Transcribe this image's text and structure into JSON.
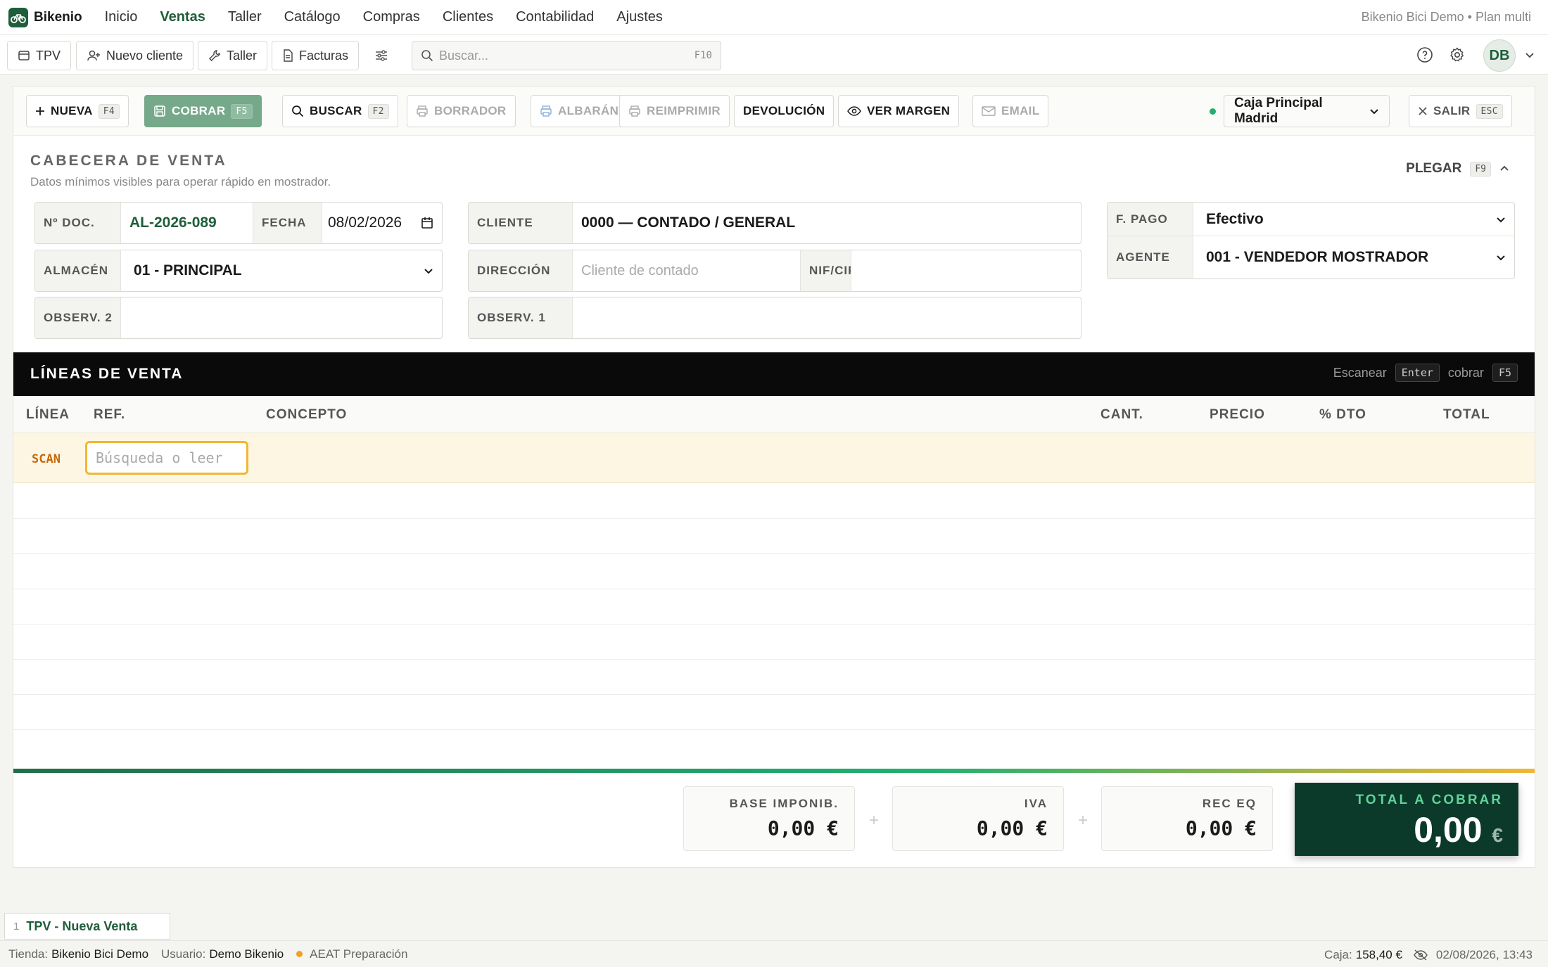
{
  "app": {
    "name": "Bikenio",
    "account": "Bikenio Bici Demo • Plan multi"
  },
  "nav": [
    "Inicio",
    "Ventas",
    "Taller",
    "Catálogo",
    "Compras",
    "Clientes",
    "Contabilidad",
    "Ajustes"
  ],
  "nav_active": "Ventas",
  "toolbar": {
    "tpv": "TPV",
    "nuevo_cliente": "Nuevo cliente",
    "taller": "Taller",
    "facturas": "Facturas",
    "search_placeholder": "Buscar...",
    "search_kbd": "F10",
    "avatar": "DB"
  },
  "actions": {
    "nueva": "NUEVA",
    "nueva_kbd": "F4",
    "cobrar": "COBRAR",
    "cobrar_kbd": "F5",
    "buscar": "BUSCAR",
    "buscar_kbd": "F2",
    "borrador": "BORRADOR",
    "albaran": "ALBARÁN",
    "reimprimir": "REIMPRIMIR",
    "devolucion": "DEVOLUCIÓN",
    "ver_margen": "VER MARGEN",
    "email": "EMAIL",
    "caja": "Caja Principal Madrid",
    "salir": "SALIR",
    "salir_kbd": "ESC"
  },
  "header": {
    "title": "CABECERA DE VENTA",
    "subtitle": "Datos mínimos visibles para operar rápido en mostrador.",
    "plegar": "PLEGAR",
    "plegar_kbd": "F9",
    "ndoc_label": "Nº DOC.",
    "ndoc": "AL-2026-089",
    "fecha_label": "FECHA",
    "fecha": "08/02/2026",
    "almacen_label": "ALMACÉN",
    "almacen": "01 - PRINCIPAL",
    "observ2_label": "OBSERV. 2",
    "observ2": "",
    "cliente_label": "CLIENTE",
    "cliente": "0000 — CONTADO / GENERAL",
    "direccion_label": "DIRECCIÓN",
    "direccion_placeholder": "Cliente de contado",
    "nif_label": "NIF/CIF",
    "nif": "",
    "observ1_label": "OBSERV. 1",
    "observ1": "",
    "fpago_label": "F. PAGO",
    "fpago": "Efectivo",
    "agente_label": "AGENTE",
    "agente": "001 - VENDEDOR MOSTRADOR"
  },
  "lines": {
    "title": "LÍNEAS DE VENTA",
    "hint_scan": "Escanear",
    "hint_enter": "Enter",
    "hint_cobrar": "cobrar",
    "hint_f5": "F5",
    "columns": [
      "LÍNEA",
      "REF.",
      "CONCEPTO",
      "CANT.",
      "PRECIO",
      "% DTO",
      "TOTAL"
    ],
    "scan_label": "SCAN",
    "scan_placeholder": "Búsqueda o leer"
  },
  "totals": {
    "base_label": "BASE IMPONIB.",
    "base": "0,00 €",
    "iva_label": "IVA",
    "iva": "0,00 €",
    "receq_label": "REC EQ",
    "receq": "0,00 €",
    "plus": "+",
    "total_label": "TOTAL A COBRAR",
    "total": "0,00",
    "currency": "€"
  },
  "tabs": [
    {
      "num": "1",
      "title": "TPV - Nueva Venta"
    }
  ],
  "status": {
    "tienda_label": "Tienda:",
    "tienda": "Bikenio Bici Demo",
    "usuario_label": "Usuario:",
    "usuario": "Demo Bikenio",
    "aeat": "AEAT Preparación",
    "caja_label": "Caja:",
    "caja": "158,40 €",
    "datetime": "02/08/2026, 13:43"
  },
  "colors": {
    "brand": "#1f5e3a",
    "accent": "#20b070",
    "warn": "#f2b632",
    "total_bg": "#0c3a2a"
  }
}
